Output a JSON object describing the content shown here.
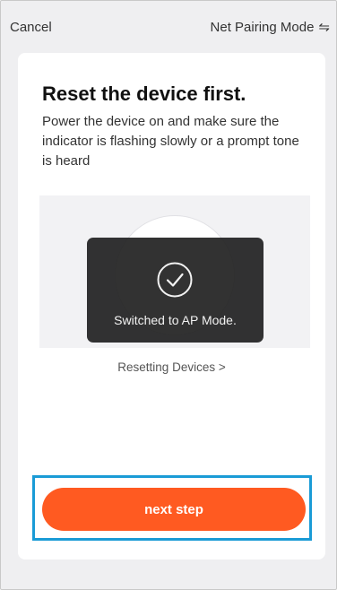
{
  "header": {
    "cancel_label": "Cancel",
    "mode_label": "Net Pairing Mode",
    "mode_icon": "⇋"
  },
  "card": {
    "title": "Reset the device first.",
    "description": "Power the device on and make sure the indicator is flashing slowly or a prompt tone is heard",
    "toast_message": "Switched to AP Mode.",
    "reset_link": "Resetting Devices >",
    "next_button": "next step"
  },
  "colors": {
    "accent": "#ff5a21",
    "highlight": "#1a9bd6",
    "background": "#efeff1",
    "toast": "#222222"
  },
  "icons": {
    "mode_switch": "swap-arrows-icon",
    "toast_status": "check-circle-icon"
  }
}
